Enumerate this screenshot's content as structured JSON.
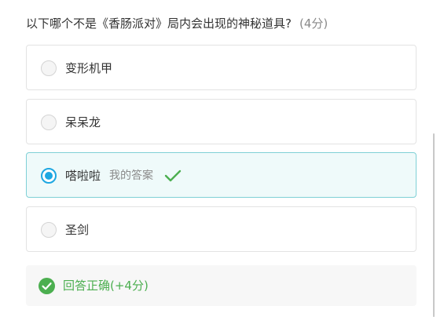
{
  "question": {
    "text": "以下哪个不是《香肠派对》局内会出现的神秘道具?",
    "score": "(4分)"
  },
  "options": [
    {
      "label": "变形机甲",
      "selected": false
    },
    {
      "label": "呆呆龙",
      "selected": false
    },
    {
      "label": "嗒啦啦",
      "selected": true,
      "my_answer_tag": "我的答案",
      "status_icon": "check-icon"
    },
    {
      "label": "圣剑",
      "selected": false
    }
  ],
  "result": {
    "icon": "check-circle-icon",
    "text": "回答正确(+4分)",
    "color": "#4caf50"
  },
  "colors": {
    "accent": "#1ea7e1",
    "selected_bg": "#effafa",
    "selected_border": "#7fd0d6",
    "correct": "#4caf50"
  }
}
